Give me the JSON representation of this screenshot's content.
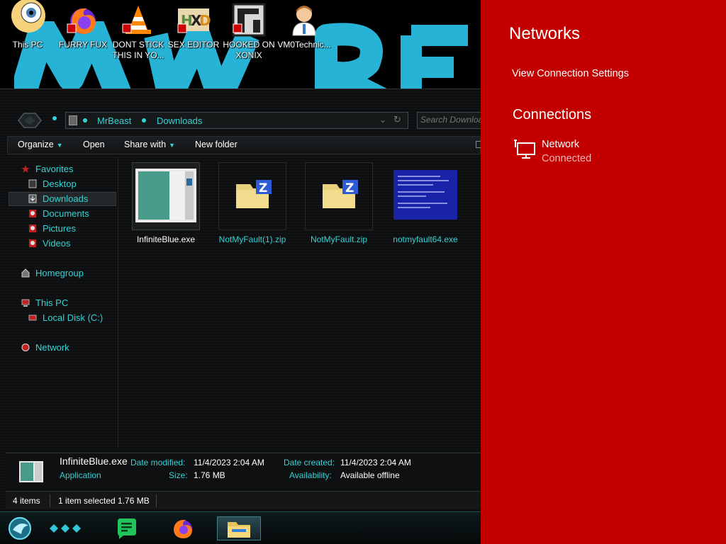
{
  "desktop": {
    "icons": [
      {
        "label": "This PC",
        "icon": "anime-avatar-icon"
      },
      {
        "label": "FURRY FUX",
        "icon": "firefox-icon"
      },
      {
        "label": "DONT STICK THIS IN YO...",
        "icon": "vlc-cone-icon"
      },
      {
        "label": "SEX EDITOR",
        "icon": "hex-editor-icon"
      },
      {
        "label": "HOOKED ON XONIX",
        "icon": "game-icon"
      },
      {
        "label": "VM0Technic...",
        "icon": "doctor-icon"
      }
    ]
  },
  "explorer": {
    "breadcrumb": [
      "MrBeast",
      "Downloads"
    ],
    "search_placeholder": "Search Downloads",
    "toolbar": {
      "organize": "Organize",
      "open": "Open",
      "share_with": "Share with",
      "new_folder": "New folder"
    },
    "nav": {
      "favorites": "Favorites",
      "desktop": "Desktop",
      "downloads": "Downloads",
      "documents": "Documents",
      "pictures": "Pictures",
      "videos": "Videos",
      "homegroup": "Homegroup",
      "this_pc": "This PC",
      "local_disk": "Local Disk (C:)",
      "network": "Network"
    },
    "files": [
      {
        "name": "InfiniteBlue.exe",
        "type": "exe-screenshot",
        "selected": true
      },
      {
        "name": "NotMyFault(1).zip",
        "type": "zip",
        "selected": false
      },
      {
        "name": "NotMyFault.zip",
        "type": "zip",
        "selected": false
      },
      {
        "name": "notmyfault64.exe",
        "type": "bsod",
        "selected": false
      }
    ],
    "details": {
      "name": "InfiniteBlue.exe",
      "type": "Application",
      "date_modified_label": "Date modified:",
      "date_modified": "11/4/2023 2:04 AM",
      "size_label": "Size:",
      "size": "1.76 MB",
      "date_created_label": "Date created:",
      "date_created": "11/4/2023 2:04 AM",
      "availability_label": "Availability:",
      "availability": "Available offline"
    },
    "status": {
      "count": "4 items",
      "selection": "1 item selected  1.76 MB"
    }
  },
  "taskbar": {
    "apps": [
      "start-orb-icon",
      "task-view-icon",
      "notes-app-icon",
      "firefox-icon",
      "file-explorer-icon"
    ]
  },
  "flyout": {
    "title": "Networks",
    "view_settings": "View Connection Settings",
    "connections_heading": "Connections",
    "network_name": "Network",
    "network_status": "Connected",
    "accent": "#c30000"
  }
}
